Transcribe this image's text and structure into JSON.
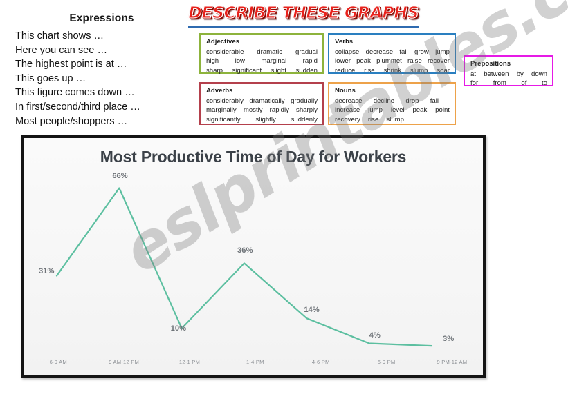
{
  "expressions": {
    "title": "Expressions",
    "items": [
      "This chart shows …",
      "Here you can see …",
      "The highest point is at …",
      "This goes up …",
      "This figure comes down …",
      "In first/second/third place …",
      "Most people/shoppers …"
    ]
  },
  "banner": {
    "title": "DESCRIBE THESE GRAPHS",
    "title_color": "#e8221c",
    "underline_color": "#2f6bb0"
  },
  "wordboxes": {
    "adjectives": {
      "heading": "Adjectives",
      "border_color": "#8db33c",
      "rows": [
        [
          "considerable",
          "dramatic",
          "gradual"
        ],
        [
          "high",
          "low",
          "marginal",
          "rapid"
        ],
        [
          "sharp",
          "significant",
          "slight",
          "sudden"
        ]
      ]
    },
    "verbs": {
      "heading": "Verbs",
      "border_color": "#2a7fc0",
      "rows": [
        [
          "collapse",
          "decrease",
          "fall",
          "grow",
          "jump"
        ],
        [
          "lower",
          "peak",
          "plummet",
          "raise",
          "recover"
        ],
        [
          "reduce",
          "rise",
          "shrink",
          "slump",
          "soar"
        ]
      ]
    },
    "adverbs": {
      "heading": "Adverbs",
      "border_color": "#b4404c",
      "rows": [
        [
          "considerably",
          "dramatically",
          "gradually"
        ],
        [
          "marginally",
          "mostly",
          "rapidly",
          "sharply"
        ],
        [
          "significantly",
          "slightly",
          "suddenly"
        ]
      ]
    },
    "nouns": {
      "heading": "Nouns",
      "border_color": "#eda24a",
      "rows": [
        [
          "decrease",
          "decline",
          "drop",
          "fall"
        ],
        [
          "increase",
          "jump",
          "level",
          "peak",
          "point"
        ],
        [
          "recovery",
          "rise",
          "slump"
        ]
      ]
    },
    "prepositions": {
      "heading": "Prepositions",
      "border_color": "#e61ae6",
      "rows": [
        [
          "at",
          "between",
          "by",
          "down"
        ],
        [
          "for",
          "from",
          "of",
          "to"
        ]
      ]
    }
  },
  "chart_data": {
    "type": "line",
    "title": "Most Productive Time of Day for Workers",
    "xlabel": "",
    "ylabel": "",
    "ylim": [
      0,
      70
    ],
    "grid": false,
    "legend": null,
    "line_color": "#5cbfa0",
    "label_color": "#6e7378",
    "categories": [
      "6-9 AM",
      "9 AM-12 PM",
      "12-1 PM",
      "1-4 PM",
      "4-6 PM",
      "6-9 PM",
      "9 PM-12 AM"
    ],
    "values": [
      31,
      66,
      10,
      36,
      14,
      4,
      3
    ],
    "data_labels": [
      "31%",
      "66%",
      "10%",
      "36%",
      "14%",
      "4%",
      "3%"
    ]
  },
  "watermark": {
    "text": "eslprintables.com"
  }
}
